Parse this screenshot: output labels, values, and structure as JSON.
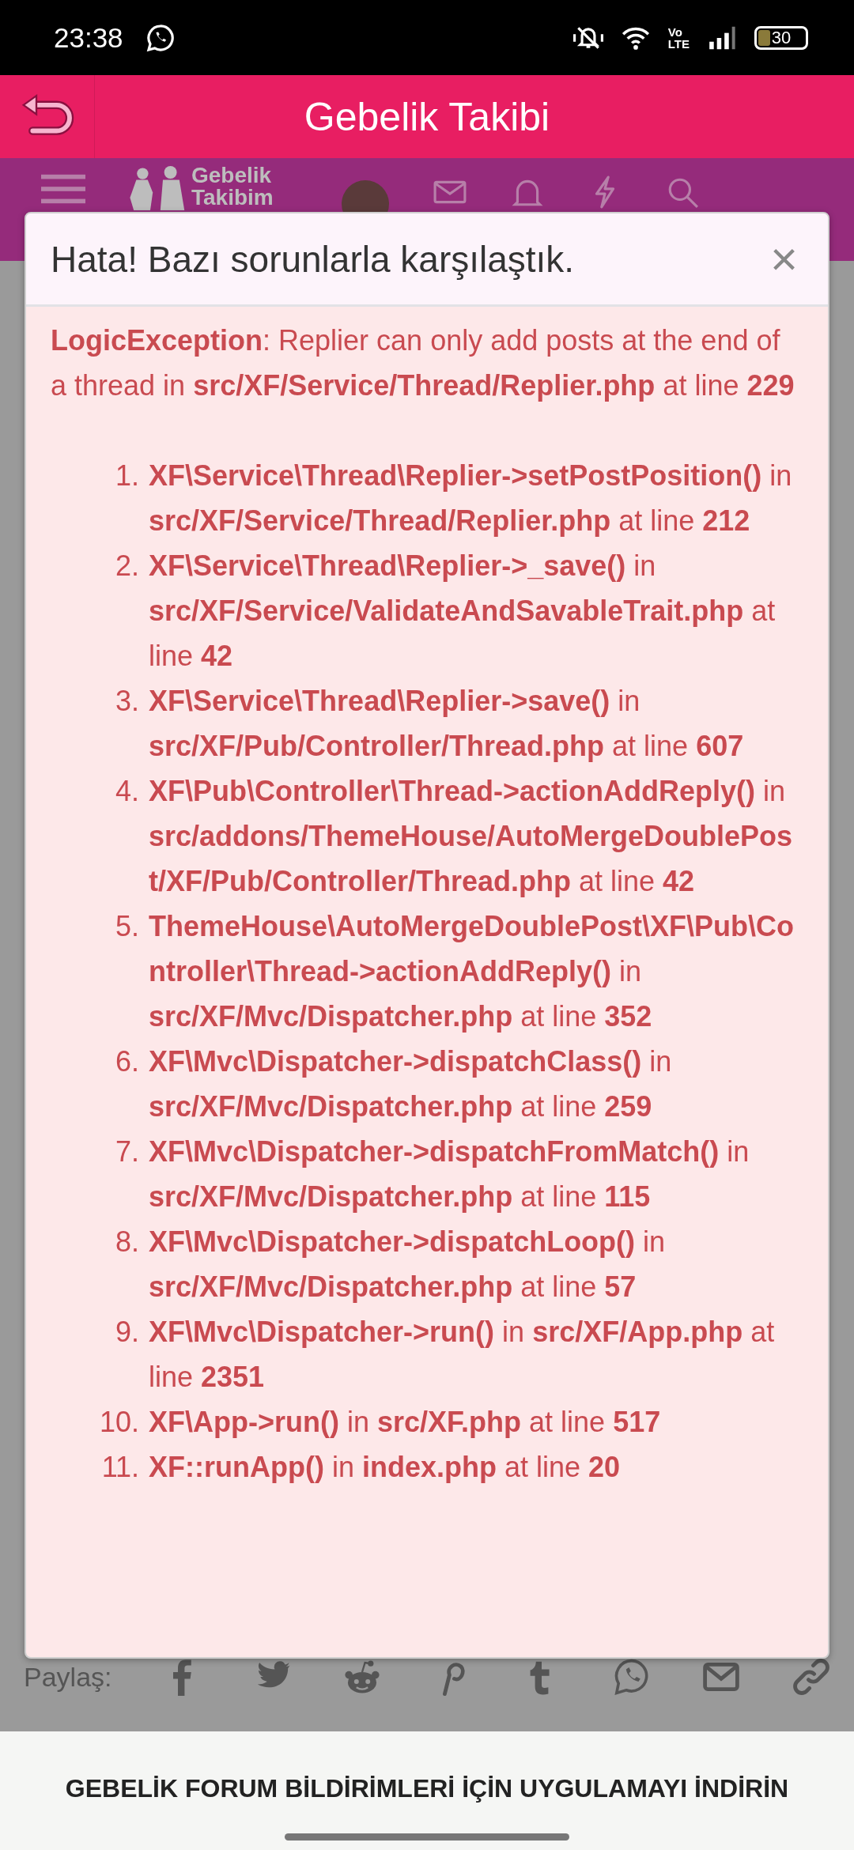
{
  "status_bar": {
    "time": "23:38",
    "network_label": [
      "Vo",
      "LTE"
    ],
    "battery": "30"
  },
  "app_bar": {
    "title": "Gebelik Takibi"
  },
  "site_nav": {
    "logo": [
      "Gebelik",
      "Takibim"
    ]
  },
  "dialog": {
    "title": "Hata! Bazı sorunlarla karşılaştık.",
    "close": "×",
    "message": "**LogicException**: Replier can only add posts at the end of a thread in **src/XF/Service/Thread/Replier.php** at line **229**",
    "trace": [
      {
        "number": "1.",
        "text": "**XF\\Service\\Thread\\Replier->setPostPosition()** in **src/XF/Service/Thread/Replier.php** at line **212**"
      },
      {
        "number": "2.",
        "text": "**XF\\Service\\Thread\\Replier->_save()** in **src/XF/Service/ValidateAndSavableTrait.php** at line **42**"
      },
      {
        "number": "3.",
        "text": "**XF\\Service\\Thread\\Replier->save()** in **src/XF/Pub/Controller/Thread.php** at line **607**"
      },
      {
        "number": "4.",
        "text": "**XF\\Pub\\Controller\\Thread->actionAddReply()** in **src/addons/ThemeHouse/AutoMergeDoublePost/XF/Pub/Controller/Thread.php** at line **42**"
      },
      {
        "number": "5.",
        "text": "**ThemeHouse\\AutoMergeDoublePost\\XF\\Pub\\Controller\\Thread->actionAddReply()** in **src/XF/Mvc/Dispatcher.php** at line **352**"
      },
      {
        "number": "6.",
        "text": "**XF\\Mvc\\Dispatcher->dispatchClass()** in **src/XF/Mvc/Dispatcher.php** at line **259**"
      },
      {
        "number": "7.",
        "text": "**XF\\Mvc\\Dispatcher->dispatchFromMatch()** in **src/XF/Mvc/Dispatcher.php** at line **115**"
      },
      {
        "number": "8.",
        "text": "**XF\\Mvc\\Dispatcher->dispatchLoop()** in **src/XF/Mvc/Dispatcher.php** at line **57**"
      },
      {
        "number": "9.",
        "text": "**XF\\Mvc\\Dispatcher->run()** in **src/XF/App.php** at line **2351**"
      },
      {
        "number": "10.",
        "text": "**XF\\App->run()** in **src/XF.php** at line **517**"
      },
      {
        "number": "11.",
        "text": "**XF::runApp()** in **index.php** at line **20**"
      }
    ]
  },
  "share": {
    "label": "Paylaş:"
  },
  "banner": {
    "text": "GEBELİK FORUM BİLDİRİMLERİ İÇİN UYGULAMAYI İNDİRİN"
  }
}
